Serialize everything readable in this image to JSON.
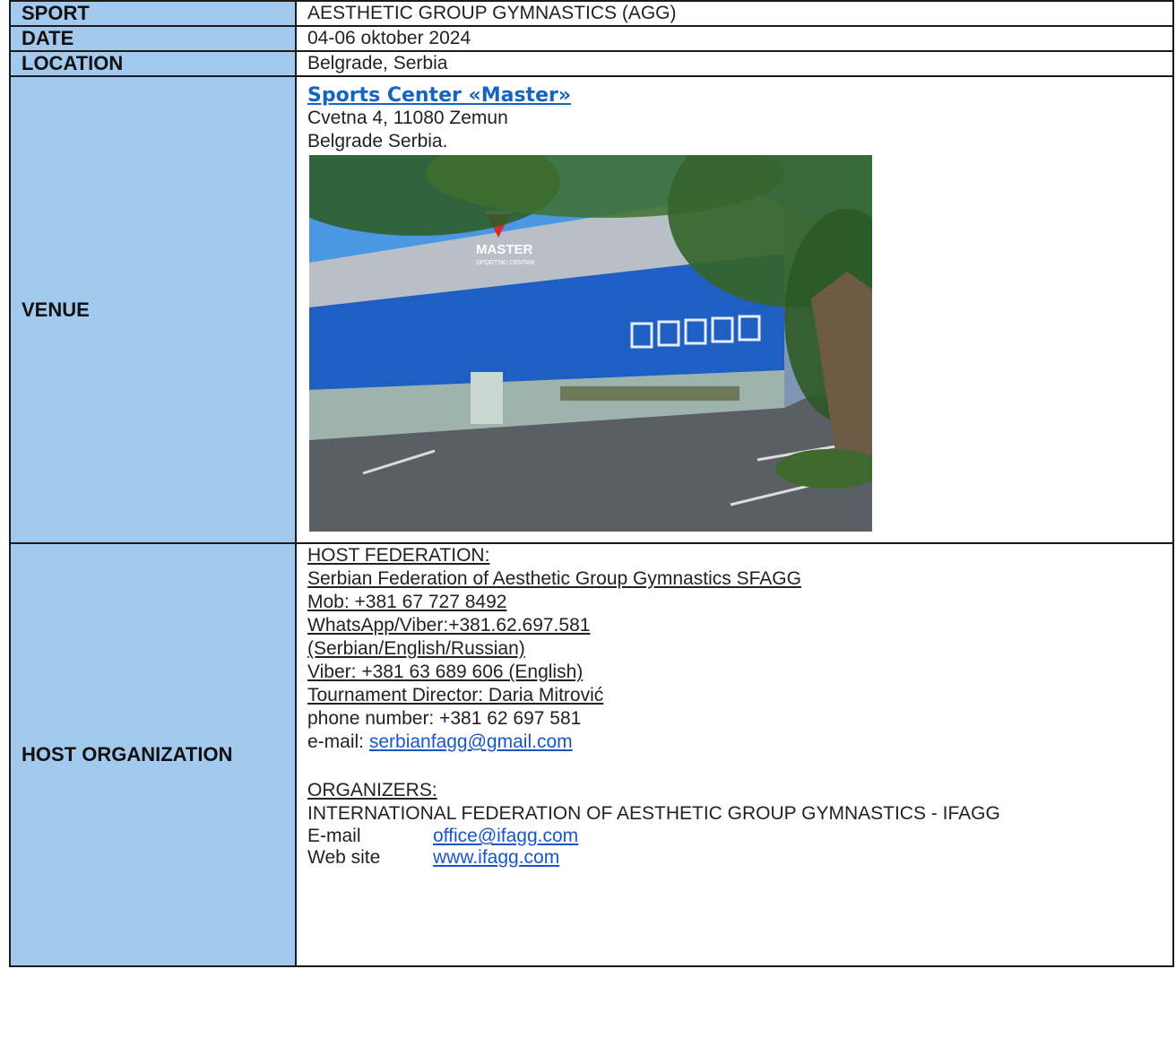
{
  "rows": {
    "sport": {
      "label": "SPORT",
      "value": "AESTHETIC GROUP GYMNASTICS (AGG)"
    },
    "date": {
      "label": "DATE",
      "value": "04-06 oktober 2024"
    },
    "location": {
      "label": "LOCATION",
      "value": "Belgrade, Serbia"
    },
    "venue": {
      "label": "VENUE",
      "name": "Sports Center «Master»",
      "address_line1": "Cvetna 4, 11080 Zemun",
      "address_line2": "Belgrade  Serbia.",
      "photo_sign_top": "MASTER",
      "photo_sign_bottom": "SPORTSKI CENTAR"
    },
    "host": {
      "label": "HOST ORGANIZATION",
      "host_federation_heading": "HOST FEDERATION:",
      "federation_name": "Serbian Federation of Aesthetic Group Gymnastics SFAGG",
      "mob": "Mob: +381 67 727 8492",
      "whatsapp": "WhatsApp/Viber:+381.62.697.581",
      "languages": "(Serbian/English/Russian)",
      "viber": "Viber: +381 63 689 606 (English)",
      "director": "Tournament Director: Daria Mitrović",
      "phone": "phone number: +381 62 697 581",
      "email_label": "e-mail: ",
      "email": "serbianfagg@gmail.com",
      "organizers_heading": "ORGANIZERS:",
      "organizer_name": "INTERNATIONAL FEDERATION OF AESTHETIC GROUP GYMNASTICS - IFAGG",
      "org_email_label": "E-mail",
      "org_email": "office@ifagg.com",
      "org_web_label": "Web site",
      "org_web": "www.ifagg.com"
    }
  },
  "colors": {
    "label_bg": "#a4c9ef",
    "link": "#1565c0",
    "building_blue": "#1f5fc4"
  }
}
